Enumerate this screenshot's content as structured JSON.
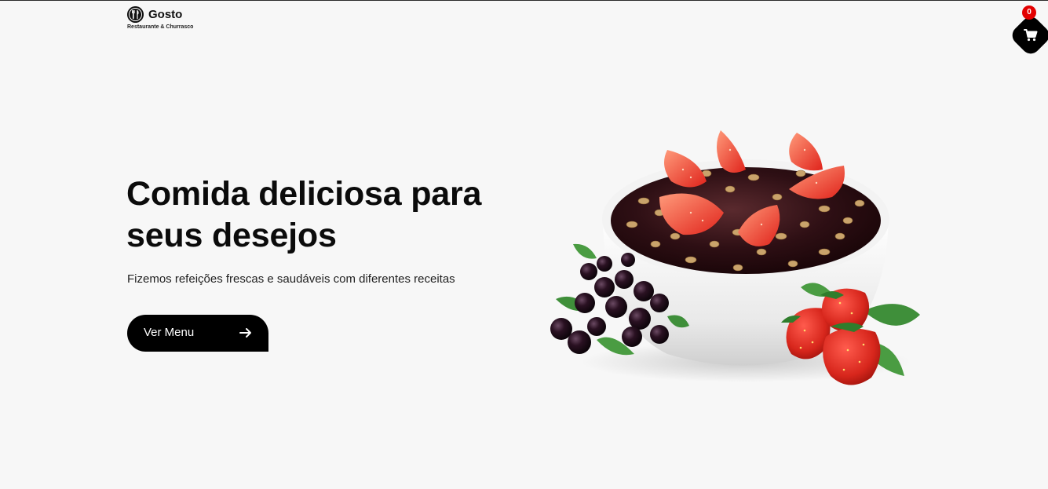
{
  "header": {
    "brand_name": "Gosto",
    "brand_tagline": "Restaurante & Churrasco",
    "logo_icon": "fork-knife-icon"
  },
  "cart": {
    "icon": "cart-icon",
    "count": "0",
    "badge_color": "#e30000",
    "background_color": "#000000"
  },
  "hero": {
    "title": "Comida deliciosa para seus desejos",
    "subtitle": "Fizemos refeições frescas e saudáveis com diferentes receitas",
    "cta_label": "Ver Menu",
    "cta_icon": "arrow-right-icon",
    "image": "acai-bowl-with-strawberries-and-granola"
  },
  "colors": {
    "background": "#f7f7f7",
    "text": "#0b0b0b",
    "accent": "#000000"
  }
}
